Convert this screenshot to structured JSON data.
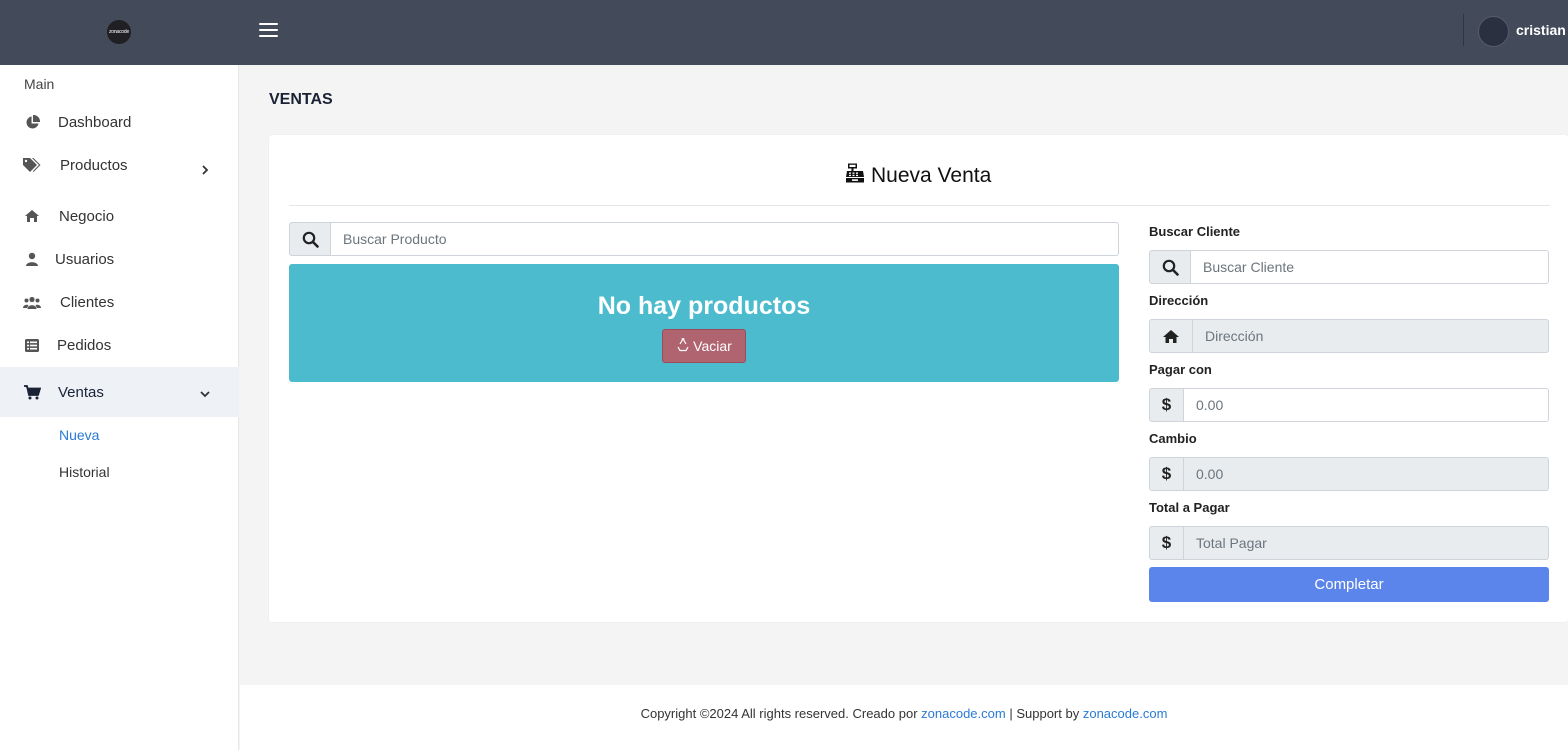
{
  "header": {
    "logo_text": "zonacode",
    "user_name": "cristian"
  },
  "sidebar": {
    "section": "Main",
    "items": [
      {
        "label": "Dashboard",
        "icon": "chart-pie-icon"
      },
      {
        "label": "Productos",
        "icon": "tags-icon"
      },
      {
        "label": "Negocio",
        "icon": "home-icon"
      },
      {
        "label": "Usuarios",
        "icon": "user-icon"
      },
      {
        "label": "Clientes",
        "icon": "users-icon"
      },
      {
        "label": "Pedidos",
        "icon": "list-icon"
      },
      {
        "label": "Ventas",
        "icon": "cart-icon"
      }
    ],
    "subitems": [
      {
        "label": "Nueva"
      },
      {
        "label": "Historial"
      }
    ]
  },
  "page": {
    "title": "VENTAS",
    "card_title": "Nueva Venta",
    "product_search_placeholder": "Buscar Producto",
    "empty_message": "No hay productos",
    "vaciar_label": "Vaciar",
    "client": {
      "label": "Buscar Cliente",
      "placeholder": "Buscar Cliente"
    },
    "direccion": {
      "label": "Dirección",
      "placeholder": "Dirección"
    },
    "pagar_con": {
      "label": "Pagar con",
      "placeholder": "0.00"
    },
    "cambio": {
      "label": "Cambio",
      "placeholder": "0.00"
    },
    "total": {
      "label": "Total a Pagar",
      "placeholder": "Total Pagar"
    },
    "complete_label": "Completar"
  },
  "footer": {
    "prefix": "Copyright ©2024 All rights reserved. Creado por",
    "link1": "zonacode.com",
    "separator": "| Support by",
    "link2": "zonacode.com"
  },
  "colors": {
    "topbar": "#434a5a",
    "accent_blue": "#5b85ea",
    "info_box": "#4bbbcd",
    "danger_btn": "#b0646f",
    "active_link": "#2a7bd6"
  }
}
